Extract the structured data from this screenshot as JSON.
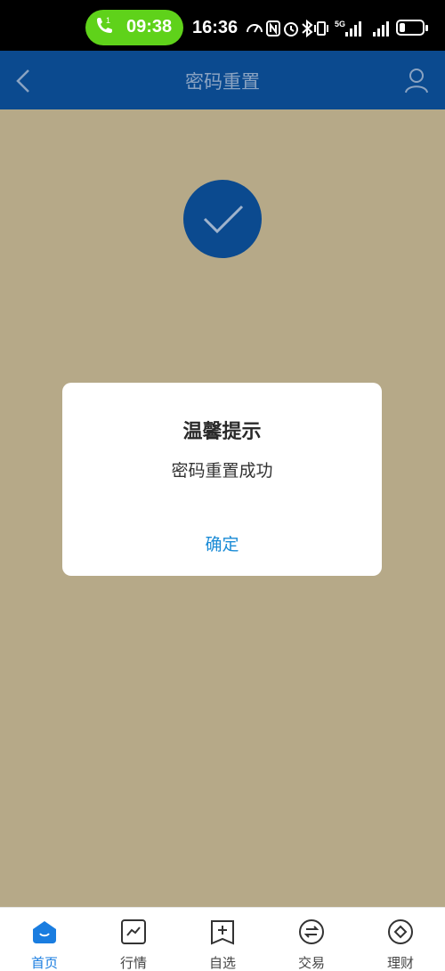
{
  "status_bar": {
    "call_time": "09:38",
    "call_badge": "1",
    "clock": "16:36",
    "network": "5G",
    "call_pill_color": "#5fd21a"
  },
  "header": {
    "title": "密码重置",
    "color": "#0b4a8f"
  },
  "dialog": {
    "title": "温馨提示",
    "message": "密码重置成功",
    "confirm_label": "确定",
    "confirm_color": "#1a8bd6"
  },
  "bottom_nav": {
    "items": [
      {
        "label": "首页",
        "icon": "home-icon",
        "active": true
      },
      {
        "label": "行情",
        "icon": "market-chart-icon",
        "active": false
      },
      {
        "label": "自选",
        "icon": "watchlist-add-icon",
        "active": false
      },
      {
        "label": "交易",
        "icon": "trade-exchange-icon",
        "active": false
      },
      {
        "label": "理财",
        "icon": "wealth-icon",
        "active": false
      }
    ],
    "active_color": "#1a7de0"
  }
}
